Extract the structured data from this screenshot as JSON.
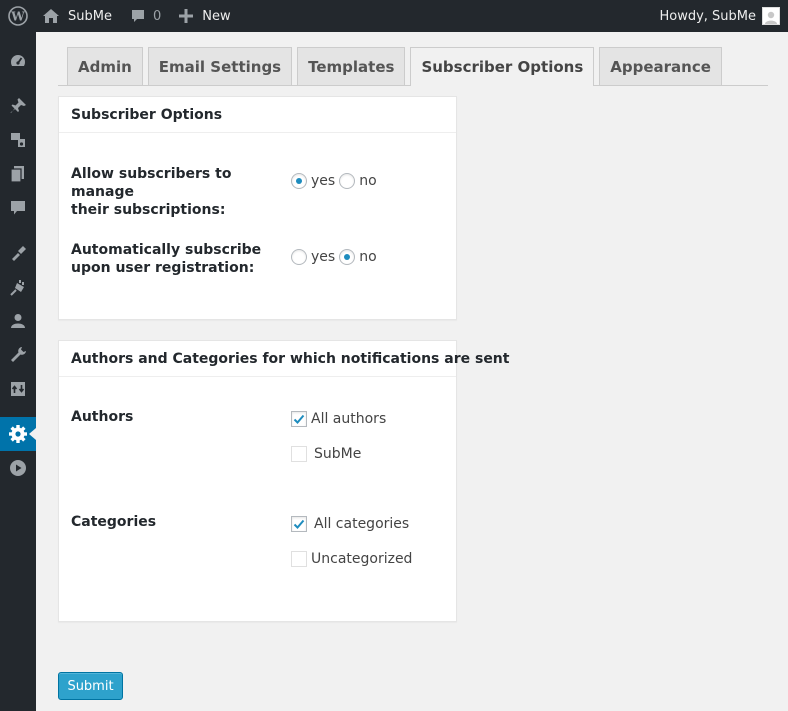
{
  "adminbar": {
    "site_name": "SubMe",
    "comments_count": "0",
    "new_label": "New",
    "howdy": "Howdy, SubMe"
  },
  "sidemenu": {
    "icons": [
      "dashboard-icon",
      "pin-icon",
      "media-icon",
      "pages-icon",
      "comments-icon",
      "appearance-icon",
      "plugins-icon",
      "users-icon",
      "tools-icon",
      "import-export-icon",
      "settings-icon",
      "play-icon"
    ],
    "current": "settings-icon"
  },
  "tabs": [
    {
      "label": "Admin"
    },
    {
      "label": "Email Settings"
    },
    {
      "label": "Templates"
    },
    {
      "label": "Subscriber Options",
      "active": true
    },
    {
      "label": "Appearance"
    }
  ],
  "subscriber_options": {
    "title": "Subscriber Options",
    "manage": {
      "label_line1": "Allow subscribers to manage",
      "label_line2": "their subscriptions:",
      "yes": "yes",
      "no": "no",
      "selected": "yes"
    },
    "auto": {
      "label_line1": "Automatically subscribe",
      "label_line2": "upon user registration:",
      "yes": "yes",
      "no": "no",
      "selected": "no"
    }
  },
  "notifications": {
    "title": "Authors and Categories for which notifications are sent",
    "authors": {
      "label": "Authors",
      "options": [
        {
          "label": "All authors",
          "checked": true
        },
        {
          "label": "SubMe",
          "checked": false
        }
      ]
    },
    "categories": {
      "label": "Categories",
      "options": [
        {
          "label": "All categories",
          "checked": true
        },
        {
          "label": "Uncategorized",
          "checked": false
        }
      ]
    }
  },
  "submit_label": "Submit",
  "colors": {
    "adminbar_bg": "#23282d",
    "accent": "#0073aa",
    "button": "#2ea2cc",
    "radio_dot": "#1e8cbe"
  }
}
